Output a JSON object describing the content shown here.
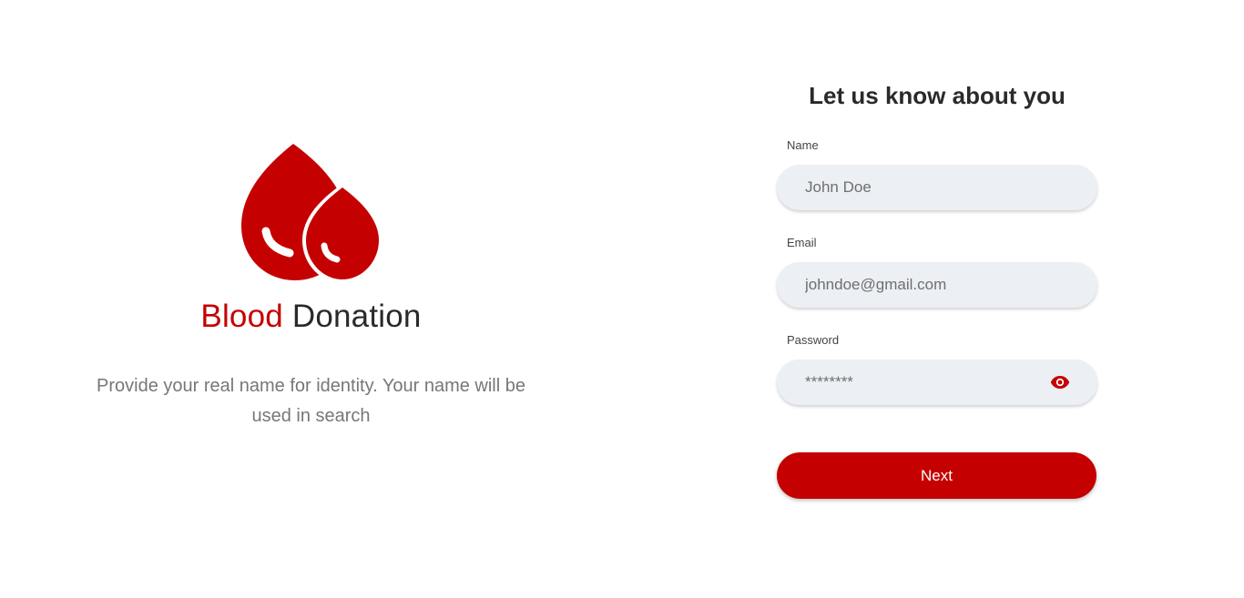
{
  "brand": {
    "title_accent": "Blood",
    "title_rest": " Donation",
    "description": "Provide your real name for identity. Your name will be used in search",
    "logo_icon": "blood-drops-icon",
    "accent_color": "#c50000"
  },
  "form": {
    "title": "Let us know about you",
    "name": {
      "label": "Name",
      "placeholder": "John Doe"
    },
    "email": {
      "label": "Email",
      "placeholder": "johndoe@gmail.com"
    },
    "password": {
      "label": "Password",
      "placeholder": "********",
      "toggle_icon": "eye-icon"
    },
    "submit_label": "Next"
  }
}
